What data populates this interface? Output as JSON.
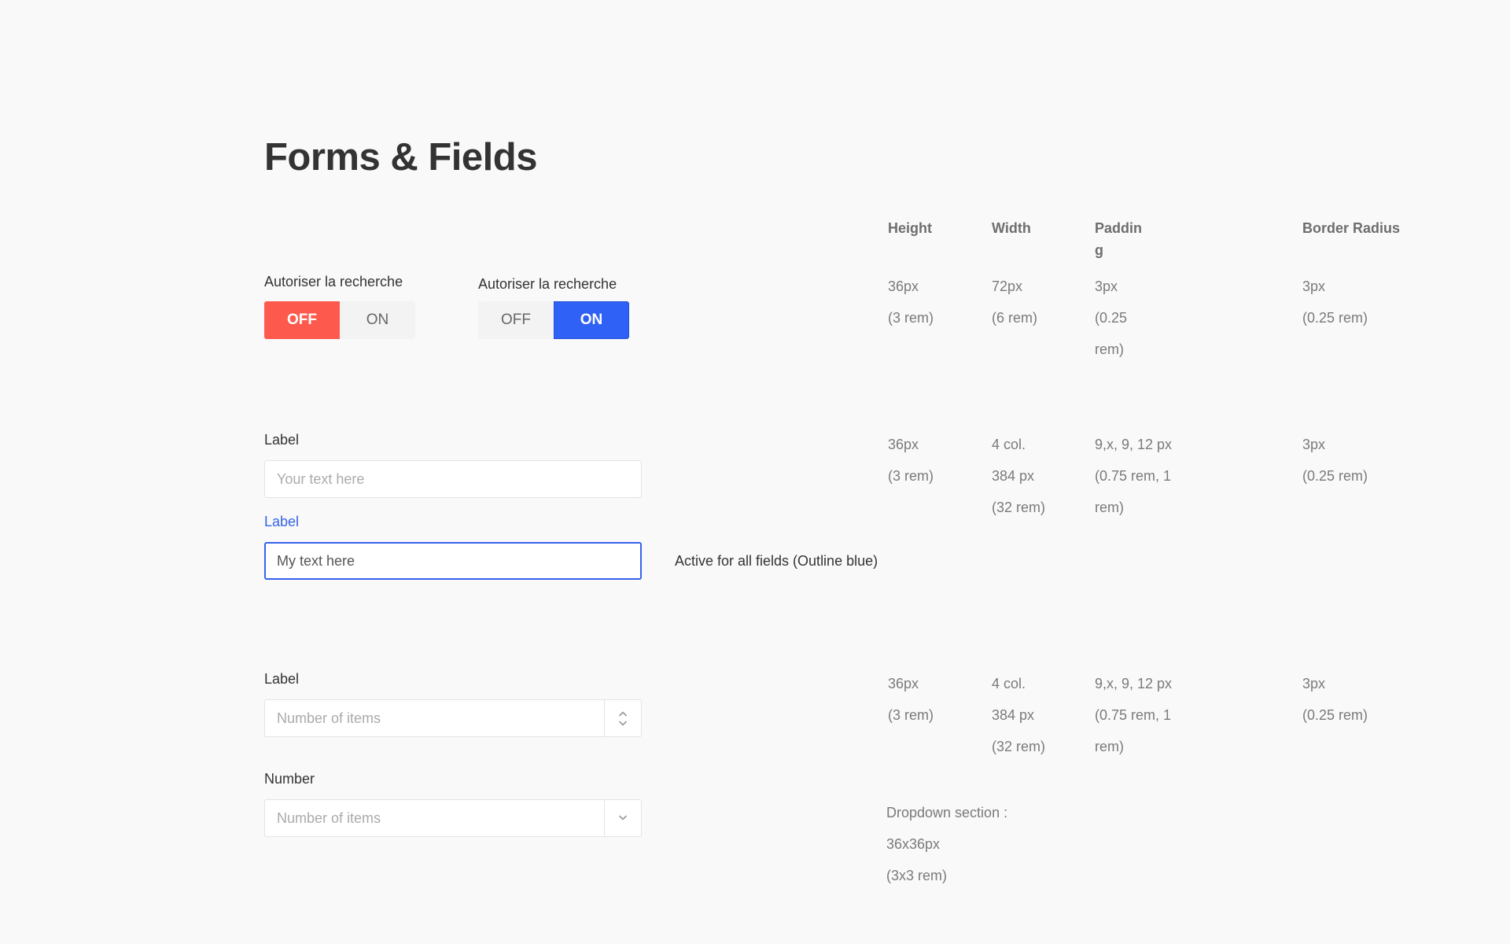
{
  "page": {
    "title": "Forms & Fields"
  },
  "table_headers": {
    "height": "Height",
    "width": "Width",
    "padding_line1": "Paddin",
    "padding_line2": "g",
    "border_radius": "Border Radius"
  },
  "toggles": [
    {
      "label": "Autoriser la recherche",
      "off_label": "OFF",
      "on_label": "ON",
      "state": "off"
    },
    {
      "label": "Autoriser la recherche",
      "off_label": "OFF",
      "on_label": "ON",
      "state": "on"
    }
  ],
  "toggle_specs": {
    "height": [
      "36px",
      "(3 rem)"
    ],
    "width": [
      "72px",
      "(6 rem)"
    ],
    "padding": [
      "3px",
      "(0.25",
      "rem)"
    ],
    "border_radius": [
      "3px",
      "(0.25 rem)"
    ]
  },
  "text_fields": {
    "default": {
      "label": "Label",
      "placeholder": "Your text here",
      "value": ""
    },
    "active": {
      "label": "Label",
      "value": "My text here"
    },
    "active_note": "Active for all fields (Outline blue)"
  },
  "text_specs": {
    "height": [
      "36px",
      "(3 rem)"
    ],
    "width": [
      "4 col.",
      "384 px",
      "(32 rem)"
    ],
    "padding": [
      "9,x, 9, 12 px",
      "(0.75 rem, 1",
      "rem)"
    ],
    "border_radius": [
      "3px",
      "(0.25 rem)"
    ]
  },
  "number_fields": {
    "stepper": {
      "label": "Label",
      "placeholder": "Number of items",
      "icons": [
        "chevron-up-icon",
        "chevron-down-icon"
      ]
    },
    "dropdown": {
      "label": "Number",
      "placeholder": "Number of items",
      "icon": "chevron-down-icon"
    }
  },
  "number_specs": {
    "height": [
      "36px",
      "(3 rem)"
    ],
    "width": [
      "4 col.",
      "384 px",
      "(32 rem)"
    ],
    "padding": [
      "9,x, 9, 12 px",
      "(0.75 rem, 1",
      "rem)"
    ],
    "border_radius": [
      "3px",
      "(0.25 rem)"
    ]
  },
  "dropdown_note": [
    "Dropdown section :",
    "36x36px",
    "(3x3 rem)"
  ],
  "colors": {
    "background": "#f9f9f9",
    "off_active": "#fd5a4d",
    "on_active": "#2f61f6",
    "focus_outline": "#3563e9",
    "inactive_segment": "#f3f3f3"
  }
}
